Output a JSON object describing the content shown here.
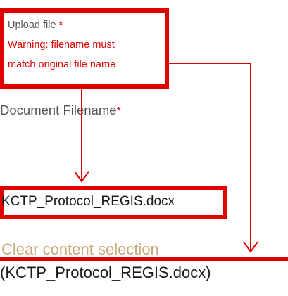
{
  "callout": {
    "upload_label": "Upload file",
    "asterisk": "*",
    "warning_line1": "Warning: filename must",
    "warning_line2": "match original file name"
  },
  "document": {
    "label": "Document Filename",
    "asterisk": "*"
  },
  "file": {
    "name": "KCTP_Protocol_REGIS.docx"
  },
  "actions": {
    "clear_label": "Clear content selection"
  },
  "selection": {
    "display": "(KCTP_Protocol_REGIS.docx)"
  },
  "colors": {
    "highlight": "#e00000",
    "link": "#c8a878",
    "label": "#555555"
  }
}
